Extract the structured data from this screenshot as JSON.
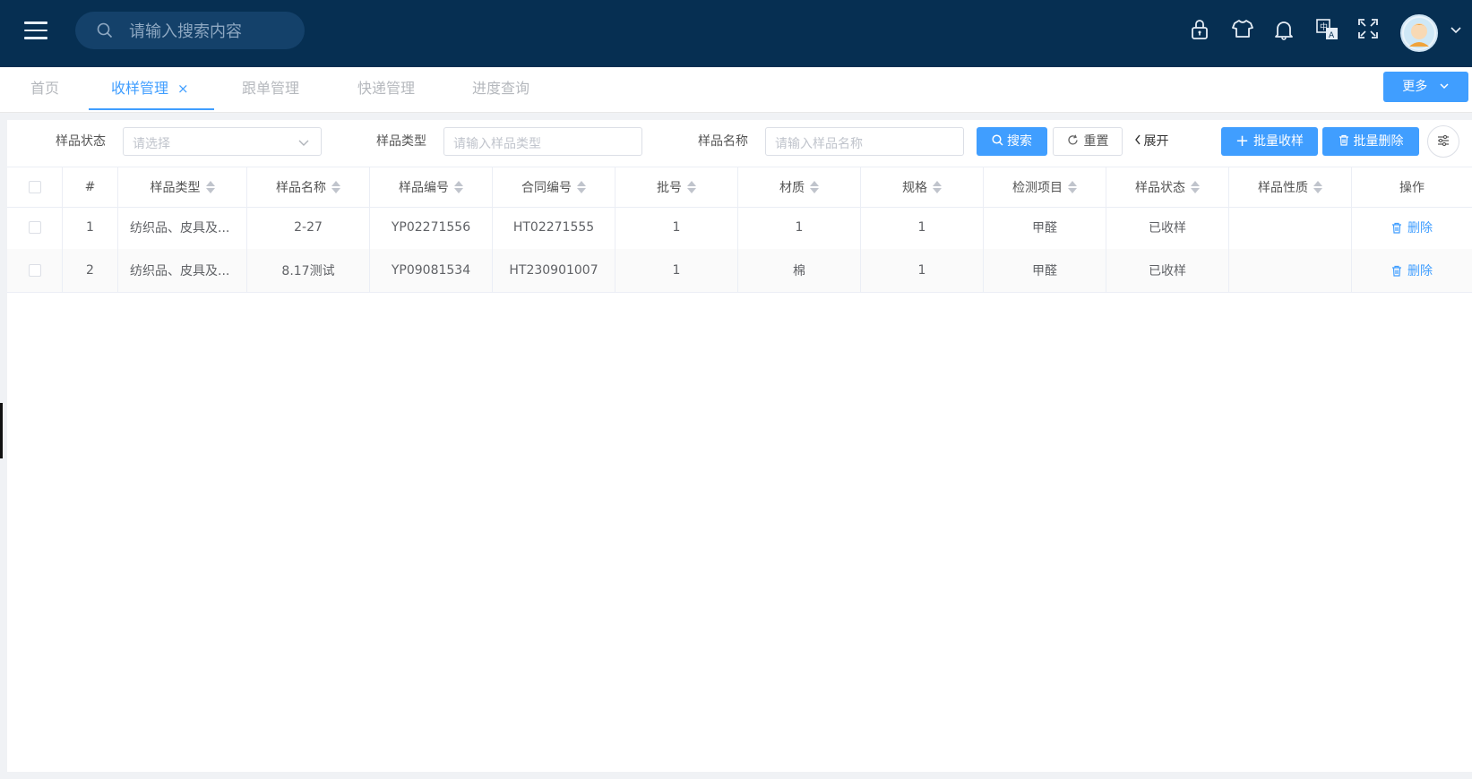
{
  "header": {
    "search_placeholder": "请输入搜索内容",
    "icons": [
      "lock-icon",
      "shirt-icon",
      "bell-icon",
      "translate-icon",
      "fullscreen-icon"
    ]
  },
  "tabs": [
    {
      "label": "首页"
    },
    {
      "label": "收样管理",
      "active": true,
      "close": "×"
    },
    {
      "label": "跟单管理"
    },
    {
      "label": "快递管理"
    },
    {
      "label": "进度查询"
    }
  ],
  "more_label": "更多",
  "filters": {
    "status_label": "样品状态",
    "status_placeholder": "请选择",
    "type_label": "样品类型",
    "type_placeholder": "请输入样品类型",
    "name_label": "样品名称",
    "name_placeholder": "请输入样品名称",
    "search_label": "搜索",
    "reset_label": "重置",
    "expand_label": "展开",
    "batch_receive_label": "批量收样",
    "batch_delete_label": "批量删除"
  },
  "table": {
    "columns": [
      "#",
      "样品类型",
      "样品名称",
      "样品编号",
      "合同编号",
      "批号",
      "材质",
      "规格",
      "检测项目",
      "样品状态",
      "样品性质",
      "操作"
    ],
    "rows": [
      {
        "index": "1",
        "type": "纺织品、皮具及...",
        "name": "2-27",
        "sample_no": "YP02271556",
        "contract_no": "HT02271555",
        "batch": "1",
        "material": "1",
        "spec": "1",
        "item": "甲醛",
        "status": "已收样",
        "nature": "",
        "action": "删除"
      },
      {
        "index": "2",
        "type": "纺织品、皮具及...",
        "name": "8.17测试",
        "sample_no": "YP09081534",
        "contract_no": "HT230901007",
        "batch": "1",
        "material": "棉",
        "spec": "1",
        "item": "甲醛",
        "status": "已收样",
        "nature": "",
        "action": "删除"
      }
    ]
  },
  "colors": {
    "header_bg": "#062f52",
    "primary": "#409eff"
  }
}
